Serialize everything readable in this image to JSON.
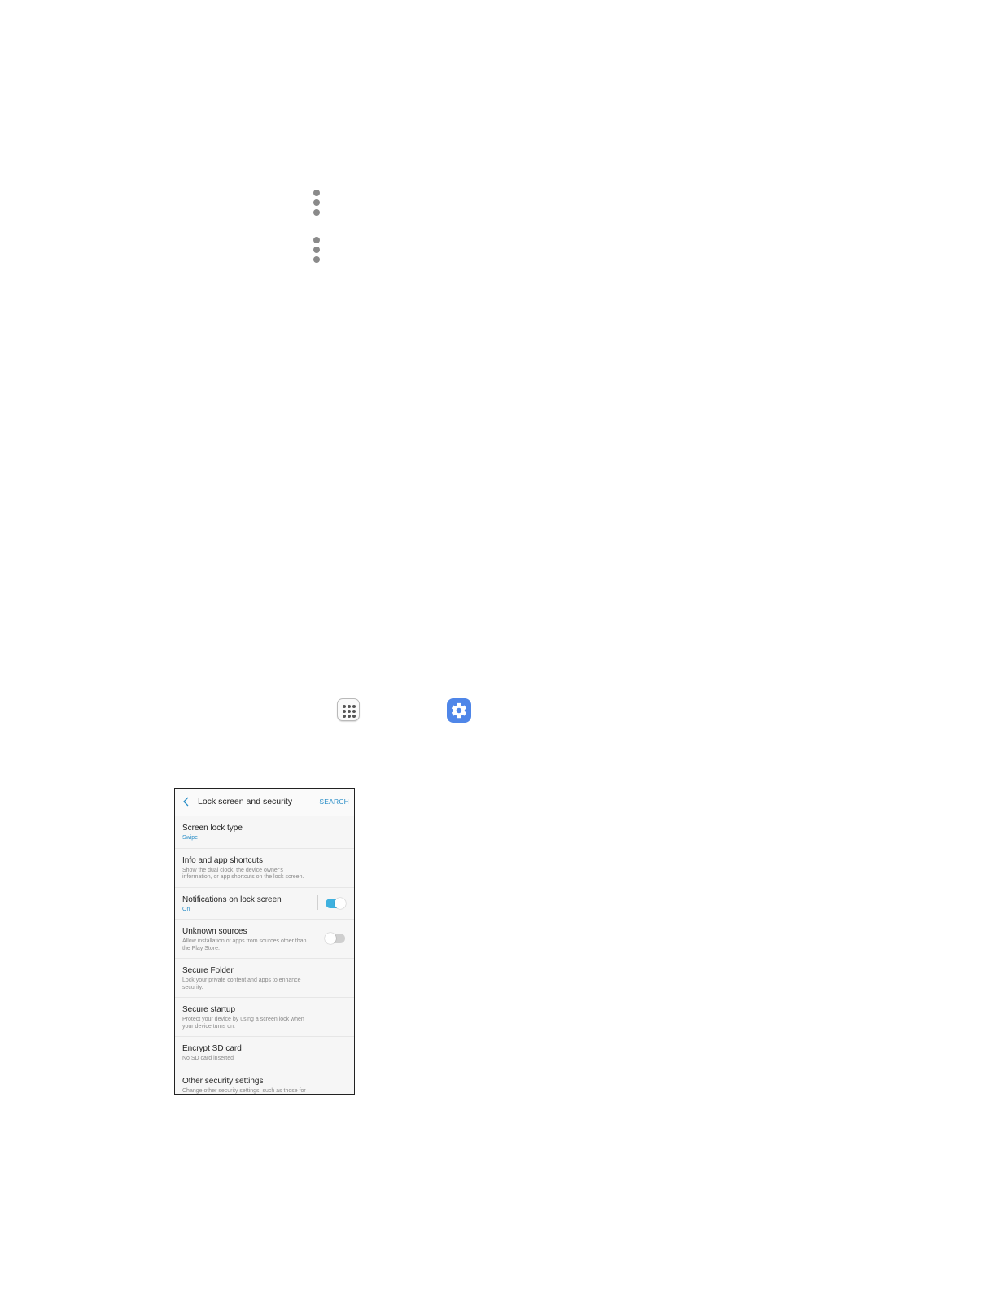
{
  "icons": {
    "kebab_1": "more-options-icon",
    "kebab_2": "more-options-icon",
    "apps": "apps-icon",
    "settings": "settings-icon"
  },
  "colors": {
    "accent": "#2a8ec7",
    "toggle_on": "#3fb1df",
    "settings_icon_bg": "#4f86e8"
  },
  "phone": {
    "header": {
      "title": "Lock screen and security",
      "search_label": "SEARCH"
    },
    "rows": [
      {
        "title": "Screen lock type",
        "subtitle": "Swipe"
      },
      {
        "title": "Info and app shortcuts",
        "subtitle": "Show the dual clock, the device owner's information, or app shortcuts on the lock screen."
      },
      {
        "title": "Notifications on lock screen",
        "subtitle": "On",
        "toggle": "on"
      },
      {
        "title": "Unknown sources",
        "subtitle": "Allow installation of apps from sources other than the Play Store.",
        "toggle": "off"
      },
      {
        "title": "Secure Folder",
        "subtitle": "Lock your private content and apps to enhance security."
      },
      {
        "title": "Secure startup",
        "subtitle": "Protect your device by using a screen lock when your device turns on."
      },
      {
        "title": "Encrypt SD card",
        "subtitle": "No SD card inserted"
      },
      {
        "title": "Other security settings",
        "subtitle": "Change other security settings, such as those for"
      }
    ]
  }
}
